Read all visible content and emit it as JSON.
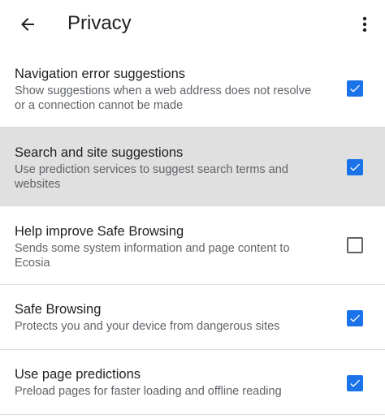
{
  "app_bar": {
    "title": "Privacy",
    "back_icon": "arrow-back-icon",
    "more_icon": "more-vert-icon"
  },
  "colors": {
    "accent": "#1a73e8",
    "highlight_row": "#e0e0e0",
    "divider": "#dadce0",
    "secondary_text": "#5f6368"
  },
  "settings": [
    {
      "label": "Navigation error suggestions",
      "summary": "Show suggestions when a web address does not resolve or a connection cannot be made",
      "checked": true
    },
    {
      "label": "Search and site suggestions",
      "summary": "Use prediction services to suggest search terms and websites",
      "checked": true,
      "highlighted": true
    },
    {
      "label": "Help improve Safe Browsing",
      "summary": "Sends some system information and page content to Ecosia",
      "checked": false
    },
    {
      "label": "Safe Browsing",
      "summary": "Protects you and your device from dangerous sites",
      "checked": true
    },
    {
      "label": "Use page predictions",
      "summary": "Preload pages for faster loading and offline reading",
      "checked": true
    }
  ]
}
